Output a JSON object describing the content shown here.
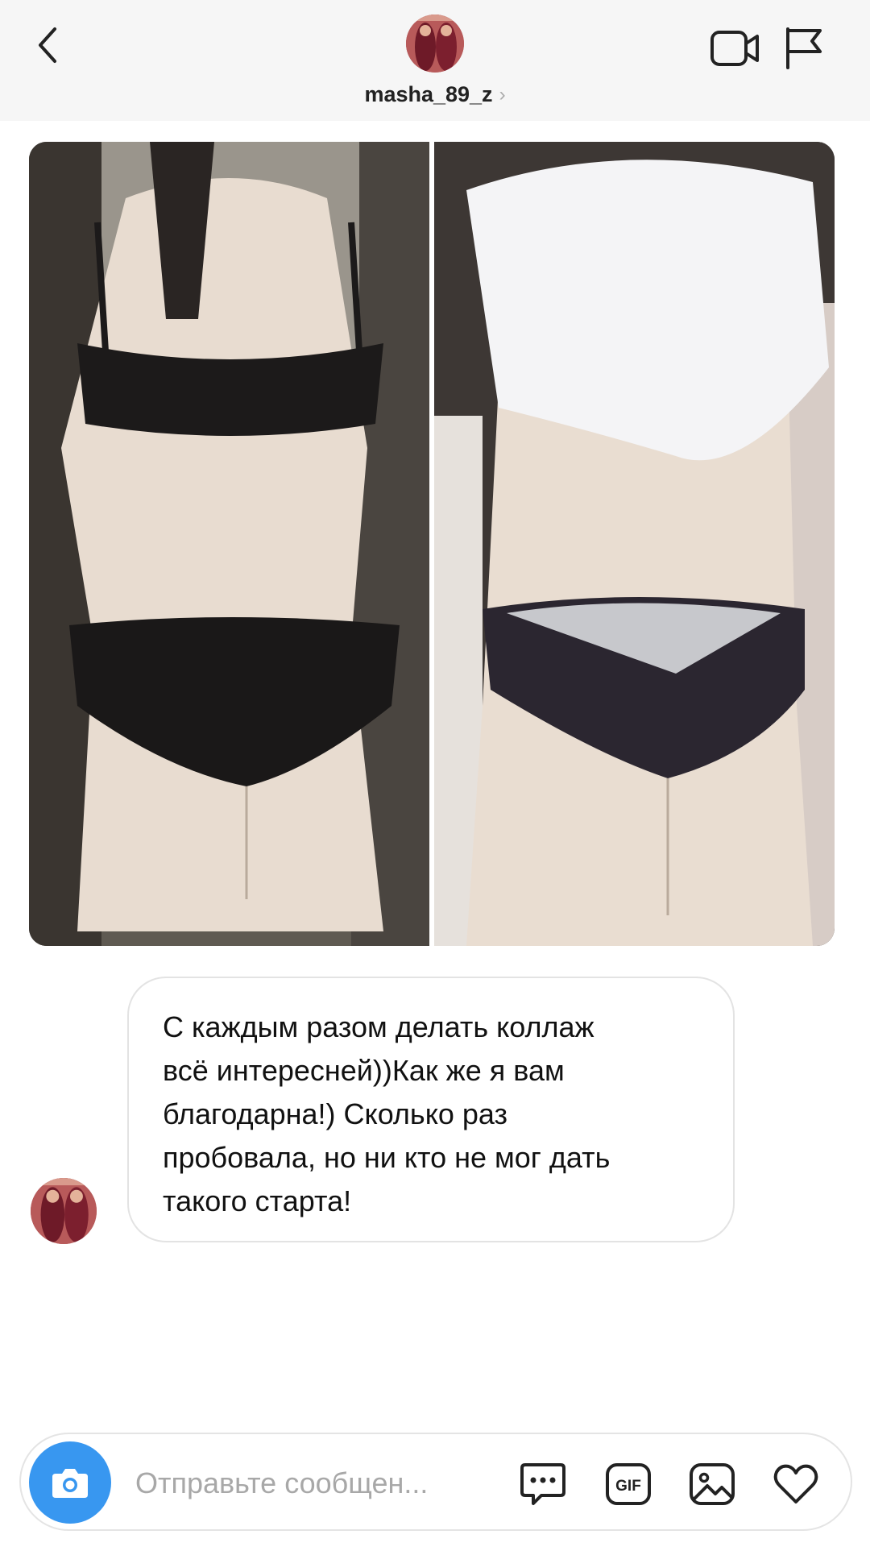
{
  "header": {
    "username": "masha_89_z",
    "username_chevron": "›",
    "icons": [
      "back-icon",
      "video-call-icon",
      "report-flag-icon"
    ]
  },
  "media": {
    "layout": "side-by-side collage",
    "photos": [
      "before-photo",
      "after-photo"
    ]
  },
  "message": {
    "text": "С каждым разом делать коллаж\nвсё интересней))Как же я вам\nблагодарна!) Сколько раз\nпробовала, но ни кто не мог дать\nтакого старта!"
  },
  "composer": {
    "placeholder": "Отправьте сообщен...",
    "icons": [
      "camera-icon",
      "sticker-icon",
      "gif-icon",
      "gallery-icon",
      "heart-icon"
    ]
  },
  "colors": {
    "accent": "#3897f0",
    "header_bg": "#f6f6f6",
    "bubble_border": "#e3e3e3"
  }
}
